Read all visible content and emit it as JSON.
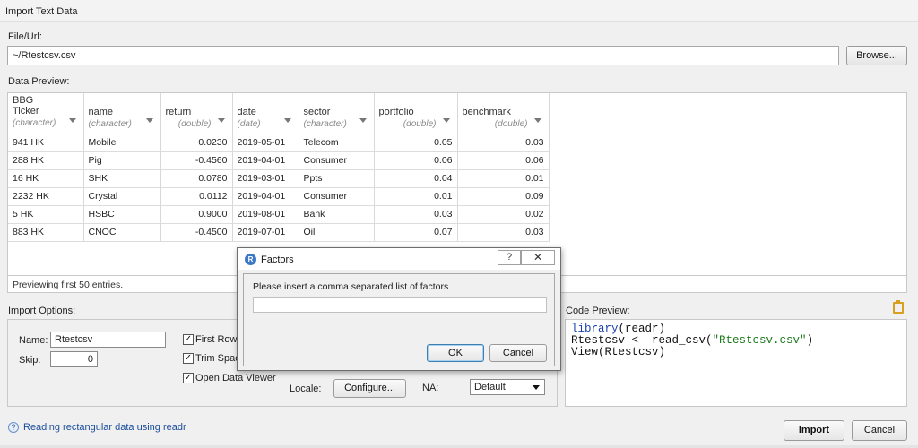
{
  "window": {
    "title": "Import Text Data"
  },
  "file": {
    "label": "File/Url:",
    "value": "~/Rtestcsv.csv",
    "browse_label": "Browse..."
  },
  "preview": {
    "label": "Data Preview:",
    "columns": [
      {
        "name": "BBG Ticker",
        "type": "(character)"
      },
      {
        "name": "name",
        "type": "(character)"
      },
      {
        "name": "return",
        "type": "(double)"
      },
      {
        "name": "date",
        "type": "(date)"
      },
      {
        "name": "sector",
        "type": "(character)"
      },
      {
        "name": "portfolio",
        "type": "(double)"
      },
      {
        "name": "benchmark",
        "type": "(double)"
      }
    ],
    "rows": [
      [
        "941 HK",
        "Mobile",
        "0.0230",
        "2019-05-01",
        "Telecom",
        "0.05",
        "0.03"
      ],
      [
        "288 HK",
        "Pig",
        "-0.4560",
        "2019-04-01",
        "Consumer",
        "0.06",
        "0.06"
      ],
      [
        "16 HK",
        "SHK",
        "0.0780",
        "2019-03-01",
        "Ppts",
        "0.04",
        "0.01"
      ],
      [
        "2232 HK",
        "Crystal",
        "0.0112",
        "2019-04-01",
        "Consumer",
        "0.01",
        "0.09"
      ],
      [
        "5 HK",
        "HSBC",
        "0.9000",
        "2019-08-01",
        "Bank",
        "0.03",
        "0.02"
      ],
      [
        "883 HK",
        "CNOC",
        "-0.4500",
        "2019-07-01",
        "Oil",
        "0.07",
        "0.03"
      ]
    ],
    "footer": "Previewing first 50 entries."
  },
  "import_options": {
    "label": "Import Options:",
    "name_label": "Name:",
    "name_value": "Rtestcsv",
    "skip_label": "Skip:",
    "skip_value": "0",
    "first_row_label": "First Row a",
    "trim_spaces_label": "Trim Spac",
    "open_viewer_label": "Open Data Viewer",
    "locale_label": "Locale:",
    "configure_label": "Configure...",
    "na_label": "NA:",
    "na_value": "Default"
  },
  "code_preview": {
    "label": "Code Preview:",
    "line1_kw": "library",
    "line1_rest": "(readr)",
    "line2_a": "Rtestcsv <- read_csv(",
    "line2_str": "\"Rtestcsv.csv\"",
    "line2_b": ")",
    "line3": "View(Rtestcsv)"
  },
  "footer": {
    "help_text": "Reading rectangular data using readr",
    "import_label": "Import",
    "cancel_label": "Cancel"
  },
  "dialog": {
    "title": "Factors",
    "help_glyph": "?",
    "close_glyph": "✕",
    "prompt": "Please insert a comma separated list of factors",
    "input_value": "",
    "ok_label": "OK",
    "cancel_label": "Cancel"
  }
}
